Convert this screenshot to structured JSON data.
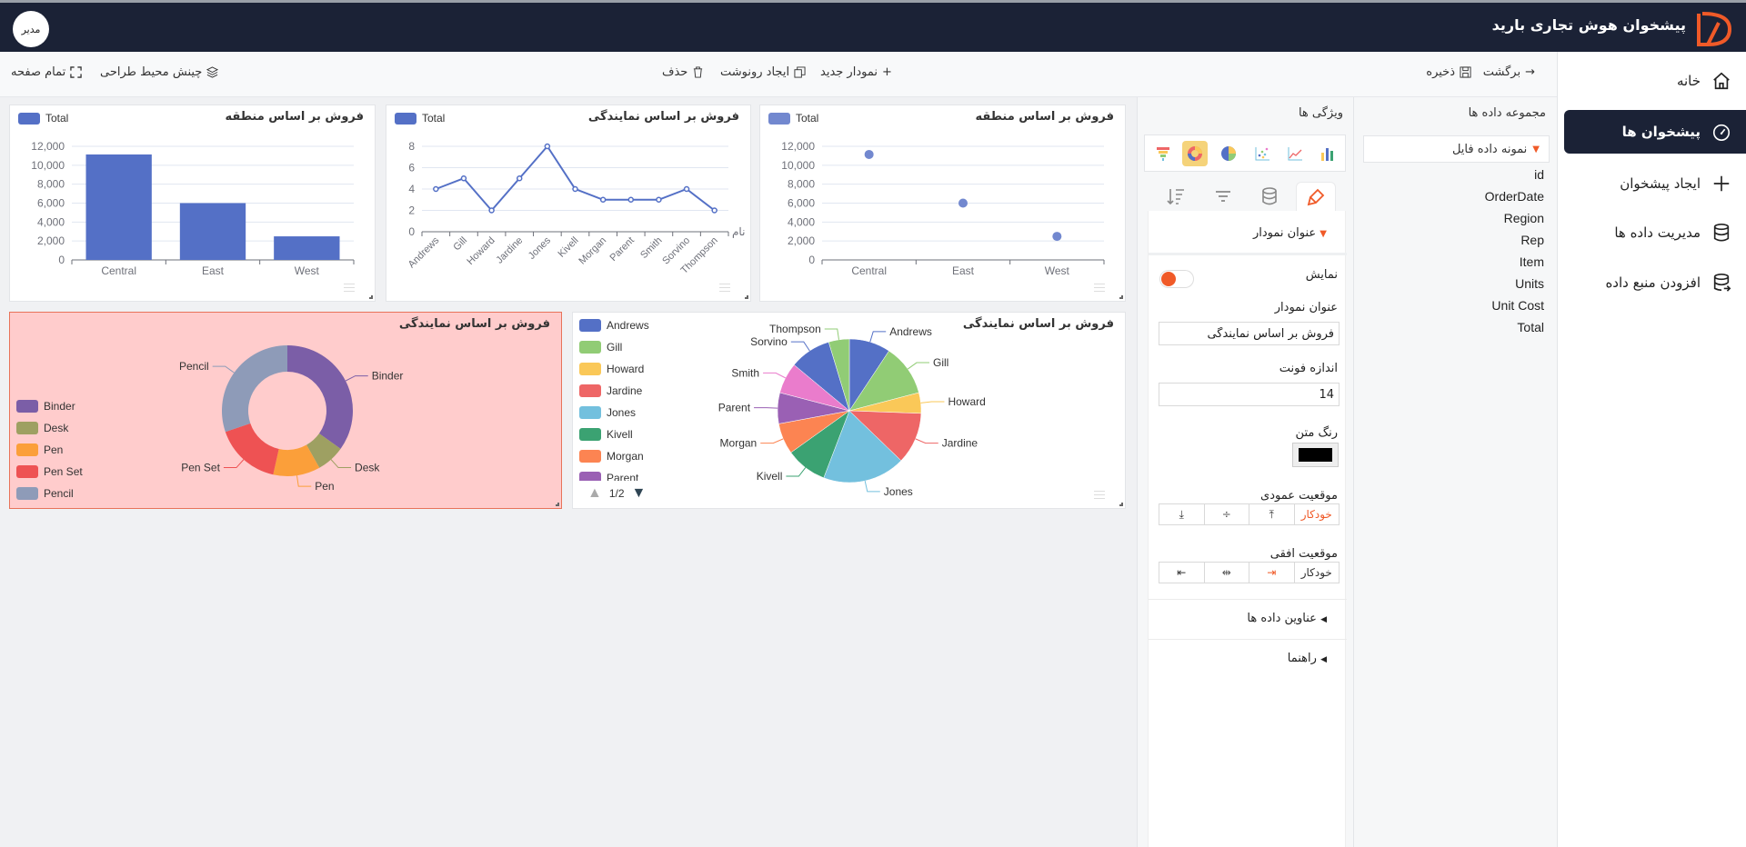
{
  "header": {
    "title": "پیشخوان هوش تجاری بارید",
    "user_badge": "مدیر"
  },
  "sidebar": {
    "items": [
      {
        "label": "خانه",
        "icon": "home-icon",
        "active": false
      },
      {
        "label": "پیشخوان ها",
        "icon": "dashboard-icon",
        "active": true
      },
      {
        "label": "ایجاد پیشخوان",
        "icon": "plus-icon",
        "active": false
      },
      {
        "label": "مدیریت داده ها",
        "icon": "database-icon",
        "active": false
      },
      {
        "label": "افزودن منبع داده",
        "icon": "database-add-icon",
        "active": false
      }
    ]
  },
  "toolbar": {
    "back": "برگشت",
    "save": "ذخیره",
    "new_chart": "نمودار جدید",
    "duplicate": "ایجاد رونوشت",
    "delete": "حذف",
    "arrange": "چینش محیط طراحی",
    "fullscreen": "تمام صفحه"
  },
  "dataset": {
    "title": "مجموعه داده ها",
    "source": "نمونه داده فایل",
    "fields": [
      "id",
      "OrderDate",
      "Region",
      "Rep",
      "Item",
      "Units",
      "Unit Cost",
      "Total"
    ]
  },
  "properties": {
    "title": "ویژگی ها",
    "chart_types": [
      "bar",
      "line",
      "scatter",
      "pie",
      "donut",
      "funnel"
    ],
    "selected_type": "donut",
    "section_title": "عنوان نمودار",
    "show_label": "نمایش",
    "show_enabled": true,
    "chart_title_label": "عنوان نمودار",
    "chart_title_value": "فروش بر اساس نمایندگی",
    "font_size_label": "اندازه فونت",
    "font_size_value": "14",
    "text_color_label": "رنگ متن",
    "text_color": "#000000",
    "vertical_label": "موقعیت عمودی",
    "vertical_auto": "خودکار",
    "horizontal_label": "موقعیت افقی",
    "horizontal_auto": "خودکار",
    "data_labels_section": "عناوین داده ها",
    "legend_section": "راهنما"
  },
  "colors": {
    "nav": "#1b2236",
    "accent": "#f05a28",
    "series": "#5470c6",
    "selected_card_bg": "#ffcccc"
  },
  "chart_data": [
    {
      "type": "bar",
      "title": "فروش بر اساس منطقه",
      "legend": "Total",
      "categories": [
        "Central",
        "East",
        "West"
      ],
      "values": [
        11140,
        6000,
        2490
      ],
      "ylim": [
        0,
        12000
      ],
      "yticks": [
        "0",
        "2,000",
        "4,000",
        "6,000",
        "8,000",
        "10,000",
        "12,000"
      ],
      "grid": true,
      "legend_position": "top-left"
    },
    {
      "type": "line",
      "title": "فروش بر اساس نمایندگی",
      "legend": "Total",
      "xlabel": "نام",
      "categories": [
        "Andrews",
        "Gill",
        "Howard",
        "Jardine",
        "Jones",
        "Kivell",
        "Morgan",
        "Parent",
        "Smith",
        "Sorvino",
        "Thompson"
      ],
      "values": [
        4,
        5,
        2,
        5,
        8,
        4,
        3,
        3,
        3,
        4,
        2
      ],
      "ylim": [
        0,
        8
      ],
      "yticks": [
        "0",
        "2",
        "4",
        "6",
        "8"
      ],
      "grid": true,
      "legend_position": "top-left"
    },
    {
      "type": "scatter",
      "title": "فروش بر اساس منطقه",
      "legend": "Total",
      "categories": [
        "Central",
        "East",
        "West"
      ],
      "values": [
        11140,
        6000,
        2490
      ],
      "ylim": [
        0,
        12000
      ],
      "yticks": [
        "0",
        "2,000",
        "4,000",
        "6,000",
        "8,000",
        "10,000",
        "12,000"
      ],
      "grid": true,
      "legend_position": "top-left"
    },
    {
      "type": "pie",
      "variant": "donut",
      "title": "فروش بر اساس نمایندگی",
      "selected": true,
      "labels": [
        "Binder",
        "Desk",
        "Pen",
        "Pen Set",
        "Pencil"
      ],
      "values": [
        15,
        3,
        5,
        7,
        13
      ],
      "colors": [
        "#7b5ea7",
        "#9ea062",
        "#fb9f3a",
        "#ee5253",
        "#8e9bb8"
      ],
      "legend_position": "left"
    },
    {
      "type": "pie",
      "title": "فروش بر اساس نمایندگی",
      "labels": [
        "Andrews",
        "Gill",
        "Howard",
        "Jardine",
        "Jones",
        "Kivell",
        "Morgan",
        "Parent",
        "Smith",
        "Sorvino",
        "Thompson"
      ],
      "values": [
        4,
        5,
        2,
        5,
        8,
        4,
        3,
        3,
        3,
        4,
        2
      ],
      "colors": [
        "#5470c6",
        "#91cc75",
        "#fac858",
        "#ee6666",
        "#73c0de",
        "#3ba272",
        "#fc8452",
        "#9a60b4",
        "#ea7ccc",
        "#5470c6",
        "#91cc75"
      ],
      "legend_position": "left",
      "legend_page": "1/2"
    }
  ]
}
